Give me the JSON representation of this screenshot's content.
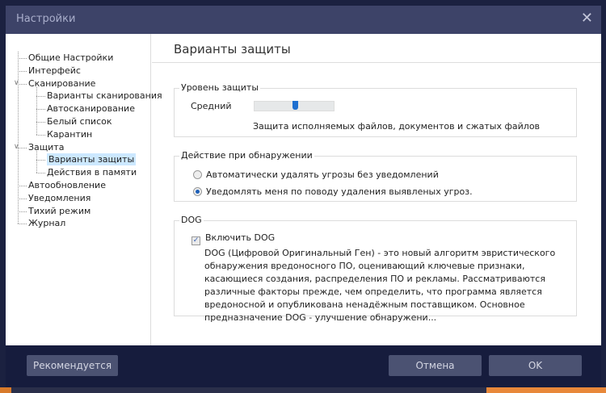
{
  "window": {
    "title": "Настройки",
    "close_icon": "close-icon"
  },
  "sidebar": {
    "items": [
      {
        "label": "Общие Настройки",
        "level": 0
      },
      {
        "label": "Интерфейс",
        "level": 0
      },
      {
        "label": "Сканирование",
        "level": 0,
        "expanded": true
      },
      {
        "label": "Варианты сканирования",
        "level": 1
      },
      {
        "label": "Автосканирование",
        "level": 1
      },
      {
        "label": "Белый список",
        "level": 1
      },
      {
        "label": "Карантин",
        "level": 1
      },
      {
        "label": "Защита",
        "level": 0,
        "expanded": true
      },
      {
        "label": "Варианты защиты",
        "level": 1,
        "selected": true
      },
      {
        "label": "Действия в памяти",
        "level": 1
      },
      {
        "label": "Автообновление",
        "level": 0
      },
      {
        "label": "Уведомления",
        "level": 0
      },
      {
        "label": "Тихий режим",
        "level": 0
      },
      {
        "label": "Журнал",
        "level": 0
      }
    ]
  },
  "main": {
    "title": "Варианты защиты",
    "level_group": {
      "label": "Уровень защиты",
      "level_name": "Средний",
      "slider_value_percent": 50,
      "description": "Защита исполняемых файлов, документов и сжатых файлов"
    },
    "action_group": {
      "label": "Действие при обнаружении",
      "options": [
        {
          "label": "Автоматически удалять угрозы без уведомлений",
          "selected": false
        },
        {
          "label": "Уведомлять меня по поводу удаления выявленых угроз.",
          "selected": true
        }
      ]
    },
    "dog_group": {
      "label": "DOG",
      "checkbox_label": "Включить DOG",
      "checked": true,
      "description": "DOG (Цифровой Оригинальный Ген) - это новый алгоритм эвристического обнаружения вредоносного ПО, оценивающий ключевые признаки, касающиеся создания, распределения ПО и рекламы. Рассматриваются различные факторы прежде, чем определить, что программа является вредоносной и опубликована ненадёжным поставщиком. Основное предназначение DOG - улучшение обнаружени..."
    }
  },
  "footer": {
    "recommended": "Рекомендуется",
    "cancel": "Отмена",
    "ok": "OK"
  },
  "colors": {
    "titlebar": "#3d4368",
    "footer": "#161c3d",
    "button": "#4b5272",
    "accent": "#1d6fd0",
    "selection": "#cce8ff"
  }
}
